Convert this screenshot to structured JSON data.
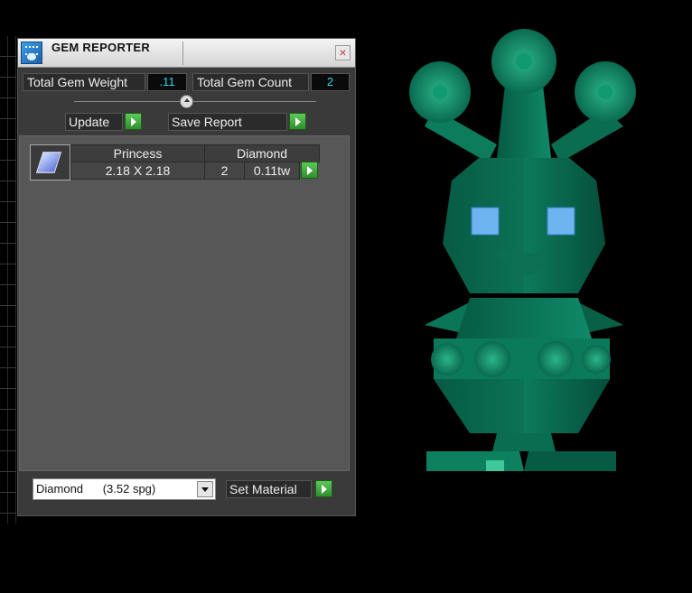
{
  "window": {
    "title": "GEM REPORTER"
  },
  "stats": {
    "weight_label": "Total Gem Weight",
    "weight_value": ".11",
    "count_label": "Total Gem Count",
    "count_value": "2"
  },
  "buttons": {
    "update": "Update",
    "save_report": "Save Report",
    "set_material": "Set Material"
  },
  "gem_table": {
    "row": {
      "shape": "Princess",
      "material": "Diamond",
      "size": "2.18 X 2.18",
      "count": "2",
      "weight": "0.11tw"
    }
  },
  "material_select": {
    "selected": "Diamond      (3.52 spg)"
  },
  "colors": {
    "model": "#0e7a5c",
    "accent_value": "#2fd6ee",
    "go_button": "#3ea83a"
  },
  "icons": [
    "app-icon",
    "close-icon",
    "go-arrow-icon",
    "chevron-down-icon",
    "gem-icon"
  ]
}
